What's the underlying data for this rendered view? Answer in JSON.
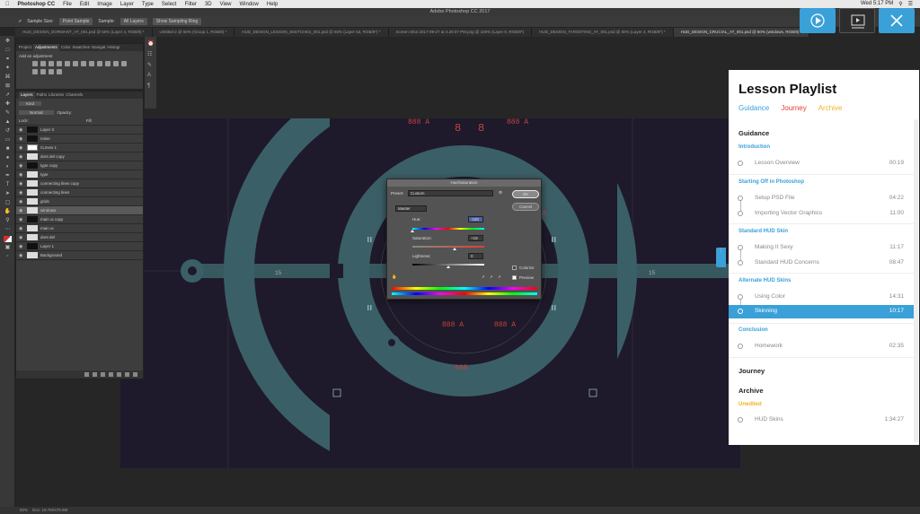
{
  "menubar": {
    "app": "Photoshop CC",
    "items": [
      "File",
      "Edit",
      "Image",
      "Layer",
      "Type",
      "Select",
      "Filter",
      "3D",
      "View",
      "Window",
      "Help"
    ],
    "clock": "Wed 5:17 PM"
  },
  "window_title": "Adobe Photoshop CC 2017",
  "options_bar": {
    "sample_size_label": "Sample Size:",
    "sample_size_value": "Point Sample",
    "sample_label": "Sample:",
    "sample_value": "All Layers",
    "show_ring": "Show Sampling Ring"
  },
  "doc_tabs": [
    "HUD_DESIGN_DORMANT_AT_001.psd @ 50% (Layer 4, RGB/8) *",
    "Untitled-2 @ 50% (Group 1, RGB/8) *",
    "HUD_DESIGN_LESSON_SKETCHES_001.psd @ 50% (Layer 53, RGB/8*) *",
    "Screen Shot 2017-09-27 at 4.29.07 PM.png @ 100% (Layer 0, RGB/8*)",
    "HUD_DESIGN_TARGETING_AT_001.psd @ 50% (Layer 3, RGB/8*) *",
    "HUD_DESIGN_CRUCIAL_AT_001.psd @ 50% (windows, RGB/8) *"
  ],
  "adjust_panel": {
    "tabs": [
      "Project",
      "Adjustments",
      "Color",
      "Swatches",
      "Navigat",
      "Histogr"
    ],
    "subtitle": "Add an adjustment"
  },
  "layers_panel": {
    "tabs": [
      "Layers",
      "Paths",
      "Libraries",
      "Channels"
    ],
    "kind_label": "Kind",
    "mode_value": "Normal",
    "opacity_label": "Opacity:",
    "fill_label": "Fill:",
    "lock_label": "Lock:",
    "rows": [
      {
        "name": "Layer 3",
        "thumb": "dark"
      },
      {
        "name": "noise",
        "thumb": "dark"
      },
      {
        "name": "Curves 1",
        "thumb": "mask"
      },
      {
        "name": "dont del copy",
        "thumb": "light"
      },
      {
        "name": "type copy",
        "thumb": "dark"
      },
      {
        "name": "type",
        "thumb": "light"
      },
      {
        "name": "connecting lines copy",
        "thumb": "light"
      },
      {
        "name": "connecting lines",
        "thumb": "light"
      },
      {
        "name": "grids",
        "thumb": "light"
      },
      {
        "name": "windows",
        "thumb": "light",
        "selected": true
      },
      {
        "name": "main ui copy",
        "thumb": "dark"
      },
      {
        "name": "main ui",
        "thumb": "light"
      },
      {
        "name": "dont del",
        "thumb": "light"
      },
      {
        "name": "Layer 1",
        "thumb": "dark"
      },
      {
        "name": "Background",
        "thumb": "light"
      }
    ]
  },
  "hud": {
    "readouts": [
      "888 A",
      "8",
      "8",
      "888 A",
      "888 A",
      "888 A",
      "888 A",
      "888"
    ],
    "side_labels": [
      "15",
      "15"
    ]
  },
  "dialog": {
    "title": "Hue/Saturation",
    "preset_label": "Preset:",
    "preset_value": "Custom",
    "ok": "OK",
    "cancel": "Cancel",
    "channel_value": "Master",
    "hue_label": "Hue:",
    "hue_value": "-180",
    "hue_pos": 0.0,
    "saturation_label": "Saturation:",
    "saturation_value": "+19",
    "saturation_pos": 0.59,
    "lightness_label": "Lightness:",
    "lightness_value": "0",
    "lightness_pos": 0.5,
    "colorize_label": "Colorize",
    "colorize_checked": false,
    "preview_label": "Preview",
    "preview_checked": true
  },
  "video_buttons": [
    {
      "name": "play",
      "color": "#3aa0d8"
    },
    {
      "name": "slides",
      "color": "#2d2d2d"
    },
    {
      "name": "expand",
      "color": "#3aa0d8"
    }
  ],
  "playlist": {
    "title": "Lesson Playlist",
    "tabs": [
      {
        "label": "Guidance",
        "color": "#3aa0d8"
      },
      {
        "label": "Journey",
        "color": "#e0412e"
      },
      {
        "label": "Archive",
        "color": "#f0b428"
      }
    ],
    "sections": {
      "guidance": "Guidance",
      "journey": "Journey",
      "archive": "Archive"
    },
    "chapters": {
      "introduction": "Introduction",
      "starting": "Starting Off in Photoshop",
      "standard": "Standard HUD Skin",
      "alternate": "Alternate HUD Skins",
      "conclusion": "Conclusion",
      "unedited": "Unedited"
    },
    "lessons": [
      {
        "name": "Lesson Overview",
        "time": "00:19"
      },
      {
        "name": "Setup PSD File",
        "time": "04:22"
      },
      {
        "name": "Importing Vector Graphics",
        "time": "11:00"
      },
      {
        "name": "Making It Sexy",
        "time": "11:17"
      },
      {
        "name": "Standard HUD Concerns",
        "time": "08:47"
      },
      {
        "name": "Using Color",
        "time": "14:31"
      },
      {
        "name": "Skinning",
        "time": "10:17"
      },
      {
        "name": "Homework",
        "time": "02:35"
      },
      {
        "name": "HUD Skins",
        "time": "1:34:27"
      }
    ]
  },
  "status": {
    "zoom": "50%",
    "doc": "Doc: 19.7M/475.8M"
  }
}
